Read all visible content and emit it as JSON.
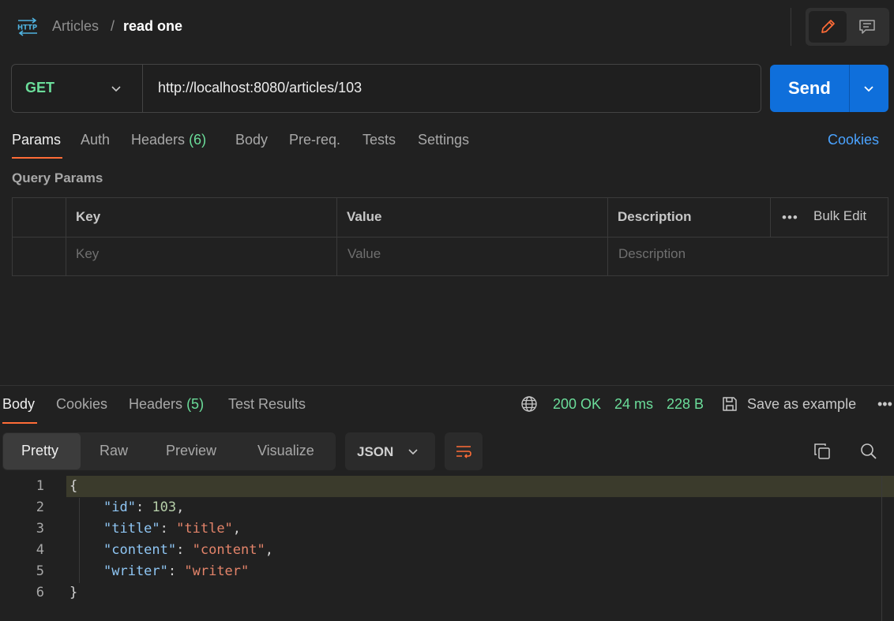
{
  "header": {
    "icon": "http-icon",
    "breadcrumb_parent": "Articles",
    "breadcrumb_sep": "/",
    "breadcrumb_current": "read one"
  },
  "request": {
    "method": "GET",
    "url": "http://localhost:8080/articles/103",
    "send_label": "Send"
  },
  "request_tabs": {
    "params": "Params",
    "auth": "Auth",
    "headers": "Headers",
    "headers_count": "(6)",
    "body": "Body",
    "prereq": "Pre-req.",
    "tests": "Tests",
    "settings": "Settings",
    "cookies": "Cookies"
  },
  "query_params": {
    "title": "Query Params",
    "columns": {
      "key": "Key",
      "value": "Value",
      "description": "Description"
    },
    "bulk_edit": "Bulk Edit",
    "more": "•••",
    "placeholders": {
      "key": "Key",
      "value": "Value",
      "description": "Description"
    }
  },
  "response": {
    "tabs": {
      "body": "Body",
      "cookies": "Cookies",
      "headers": "Headers",
      "headers_count": "(5)",
      "test_results": "Test Results"
    },
    "status": "200 OK",
    "time": "24 ms",
    "size": "228 B",
    "save_as_example": "Save as example",
    "more": "•••",
    "views": {
      "pretty": "Pretty",
      "raw": "Raw",
      "preview": "Preview",
      "visualize": "Visualize"
    },
    "format": "JSON",
    "line_numbers": [
      "1",
      "2",
      "3",
      "4",
      "5",
      "6"
    ],
    "json": {
      "open": "{",
      "close": "}",
      "fields": [
        {
          "key": "\"id\"",
          "value": "103",
          "type": "number",
          "comma": ","
        },
        {
          "key": "\"title\"",
          "value": "\"title\"",
          "type": "string",
          "comma": ","
        },
        {
          "key": "\"content\"",
          "value": "\"content\"",
          "type": "string",
          "comma": ","
        },
        {
          "key": "\"writer\"",
          "value": "\"writer\"",
          "type": "string",
          "comma": ""
        }
      ]
    }
  },
  "colors": {
    "accent_orange": "#ff6c37",
    "send_blue": "#0f6fdb",
    "success_green": "#6bdd9a",
    "link_blue": "#4aa3ff"
  }
}
